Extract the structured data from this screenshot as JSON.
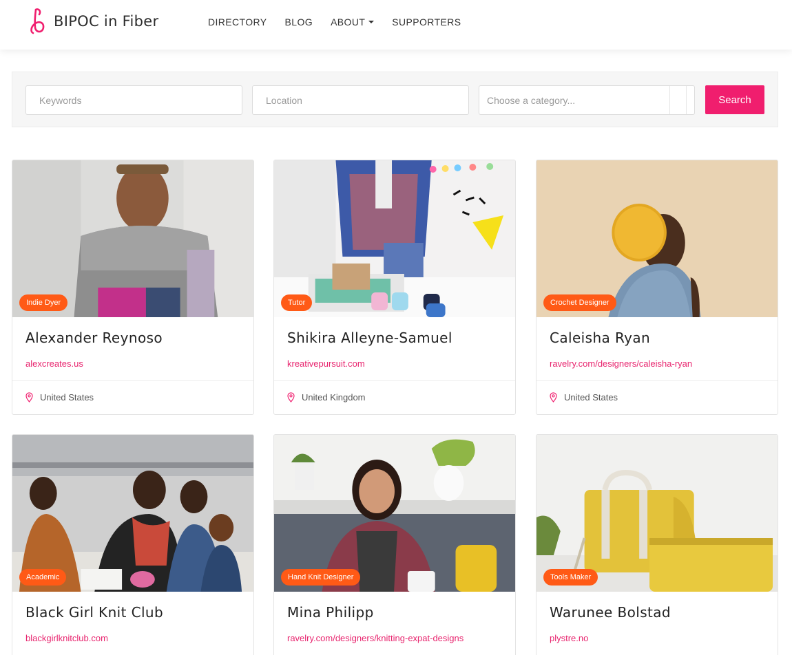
{
  "brand": {
    "name": "BIPOC in Fiber",
    "accent": "#f01e6e",
    "badge_color": "#ff5a16"
  },
  "nav": {
    "items": [
      "DIRECTORY",
      "BLOG",
      "ABOUT",
      "SUPPORTERS"
    ]
  },
  "search": {
    "keywords_placeholder": "Keywords",
    "location_placeholder": "Location",
    "category_placeholder": "Choose a category...",
    "button_label": "Search"
  },
  "cards": [
    {
      "badge": "Indie Dyer",
      "name": "Alexander Reynoso",
      "link": "alexcreates.us",
      "location": "United States"
    },
    {
      "badge": "Tutor",
      "name": "Shikira Alleyne-Samuel",
      "link": "kreativepursuit.com",
      "location": "United Kingdom"
    },
    {
      "badge": "Crochet Designer",
      "name": "Caleisha Ryan",
      "link": "ravelry.com/designers/caleisha-ryan",
      "location": "United States"
    },
    {
      "badge": "Academic",
      "name": "Black Girl Knit Club",
      "link": "blackgirlknitclub.com"
    },
    {
      "badge": "Hand Knit Designer",
      "name": "Mina Philipp",
      "link": "ravelry.com/designers/knitting-expat-designs"
    },
    {
      "badge": "Tools Maker",
      "name": "Warunee Bolstad",
      "link": "plystre.no"
    }
  ]
}
